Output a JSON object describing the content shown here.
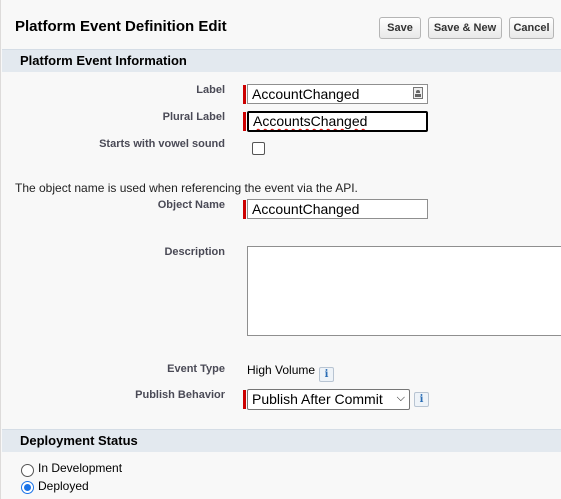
{
  "page": {
    "title": "Platform Event Definition Edit"
  },
  "toolbar": {
    "save_label": "Save",
    "save_new_label": "Save & New",
    "cancel_label": "Cancel"
  },
  "sections": {
    "info_title": "Platform Event Information",
    "deployment_title": "Deployment Status"
  },
  "fields": {
    "label": {
      "label": "Label",
      "value": "AccountChanged",
      "required": true
    },
    "plural_label": {
      "label": "Plural Label",
      "value": "AccountsChanged",
      "required": true
    },
    "vowel_sound": {
      "label": "Starts with vowel sound",
      "checked": false
    },
    "object_name_note": "The object name is used when referencing the event via the API.",
    "object_name": {
      "label": "Object Name",
      "value": "AccountChanged",
      "required": true
    },
    "description": {
      "label": "Description",
      "value": ""
    },
    "event_type": {
      "label": "Event Type",
      "value": "High Volume"
    },
    "publish_behavior": {
      "label": "Publish Behavior",
      "value": "Publish After Commit",
      "required": true
    }
  },
  "deployment": {
    "options": [
      {
        "label": "In Development",
        "selected": false
      },
      {
        "label": "Deployed",
        "selected": true
      }
    ]
  },
  "icons": {
    "info": "info-icon",
    "lookup": "lookup-icon",
    "dropdown": "chevron-down-icon"
  },
  "colors": {
    "required_bar": "#cc0000",
    "section_header": "#e3e9ef",
    "page_bg": "#f8f8f8",
    "radio_selected": "#1a73e8"
  }
}
